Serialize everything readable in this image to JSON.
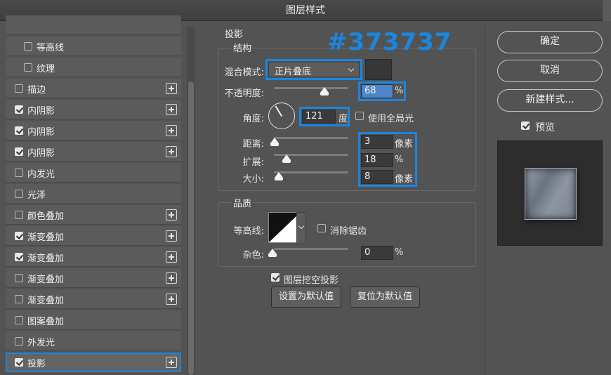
{
  "window": {
    "title": "图层样式"
  },
  "annotation": {
    "hex": "#373737"
  },
  "sidebar": {
    "items": [
      {
        "label": "等高线",
        "checked": false,
        "plus": false,
        "indent": true
      },
      {
        "label": "纹理",
        "checked": false,
        "plus": false,
        "indent": true
      },
      {
        "label": "描边",
        "checked": false,
        "plus": true
      },
      {
        "label": "内阴影",
        "checked": true,
        "plus": true
      },
      {
        "label": "内阴影",
        "checked": true,
        "plus": true
      },
      {
        "label": "内阴影",
        "checked": true,
        "plus": true
      },
      {
        "label": "内发光",
        "checked": false,
        "plus": false
      },
      {
        "label": "光泽",
        "checked": false,
        "plus": false
      },
      {
        "label": "颜色叠加",
        "checked": false,
        "plus": true
      },
      {
        "label": "渐变叠加",
        "checked": true,
        "plus": true
      },
      {
        "label": "渐变叠加",
        "checked": true,
        "plus": true
      },
      {
        "label": "渐变叠加",
        "checked": false,
        "plus": true
      },
      {
        "label": "渐变叠加",
        "checked": false,
        "plus": true
      },
      {
        "label": "图案叠加",
        "checked": false,
        "plus": false
      },
      {
        "label": "外发光",
        "checked": false,
        "plus": false
      },
      {
        "label": "投影",
        "checked": true,
        "plus": true,
        "selected": true
      }
    ]
  },
  "drop_shadow": {
    "section_title": "投影",
    "structure_title": "结构",
    "blend_mode_label": "混合模式:",
    "blend_mode_value": "正片叠底",
    "shadow_color": "#373737",
    "opacity_label": "不透明度:",
    "opacity_value": "68",
    "opacity_unit": "%",
    "opacity_level": 0.68,
    "angle_label": "角度:",
    "angle_value": "121",
    "angle_unit": "度",
    "global_light_label": "使用全局光",
    "global_light_checked": false,
    "distance_label": "距离:",
    "distance_value": "3",
    "distance_unit": "像素",
    "spread_label": "扩展:",
    "spread_value": "18",
    "spread_unit": "%",
    "size_label": "大小:",
    "size_value": "8",
    "size_unit": "像素",
    "quality_title": "品质",
    "contour_label": "等高线:",
    "anti_alias_label": "消除锯齿",
    "anti_alias_checked": false,
    "noise_label": "杂色:",
    "noise_value": "0",
    "noise_unit": "%",
    "knockout_label": "图层挖空投影",
    "knockout_checked": true,
    "make_default_label": "设置为默认值",
    "reset_default_label": "复位为默认值"
  },
  "actions": {
    "ok_label": "确定",
    "cancel_label": "取消",
    "new_style_label": "新建样式...",
    "preview_label": "预览",
    "preview_checked": true
  }
}
